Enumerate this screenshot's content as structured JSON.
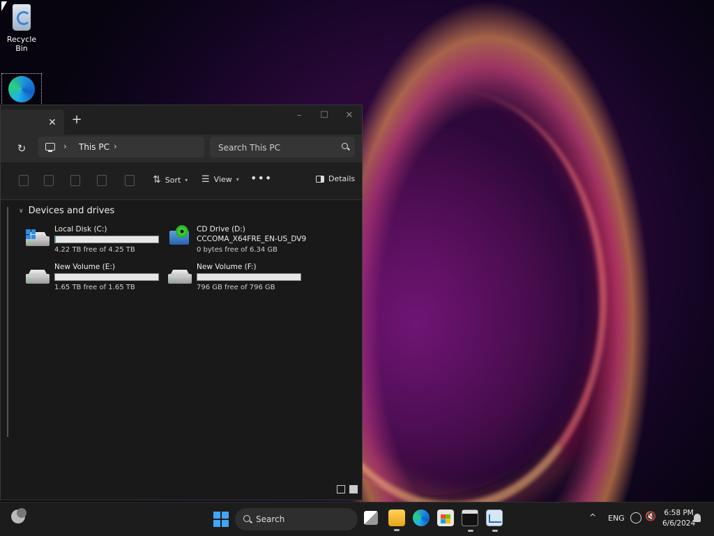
{
  "desktop": {
    "icons": [
      {
        "label": "Recycle Bin"
      }
    ]
  },
  "explorer": {
    "tab_close": "✕",
    "new_tab": "+",
    "window_controls": {
      "minimize": "–",
      "maximize": "☐",
      "close": "✕"
    },
    "address": {
      "location": "This PC",
      "separator": "›"
    },
    "search": {
      "placeholder": "Search This PC"
    },
    "toolbar": {
      "sort_label": "Sort",
      "view_label": "View",
      "more_label": "•••",
      "details_label": "Details"
    },
    "section_title": "Devices and drives",
    "drives": [
      {
        "name": "Local Disk (C:)",
        "free_text": "4.22 TB free of 4.25 TB",
        "used_fraction": 0.007,
        "icon": "windows-drive-icon"
      },
      {
        "name": "CD Drive (D:)",
        "sub": "CCCOMA_X64FRE_EN-US_DV9",
        "free_text": "0 bytes free of 6.34 GB",
        "icon": "cd-drive-icon"
      },
      {
        "name": "New Volume (E:)",
        "free_text": "1.65 TB free of 1.65 TB",
        "used_fraction": 0.0,
        "icon": "hard-drive-icon"
      },
      {
        "name": "New Volume (F:)",
        "free_text": "796 GB free of 796 GB",
        "used_fraction": 0.0,
        "icon": "hard-drive-icon"
      }
    ]
  },
  "taskbar": {
    "search_label": "Search",
    "language": "ENG",
    "time": "6:58 PM",
    "date": "6/6/2024",
    "tray_chevron": "^"
  }
}
